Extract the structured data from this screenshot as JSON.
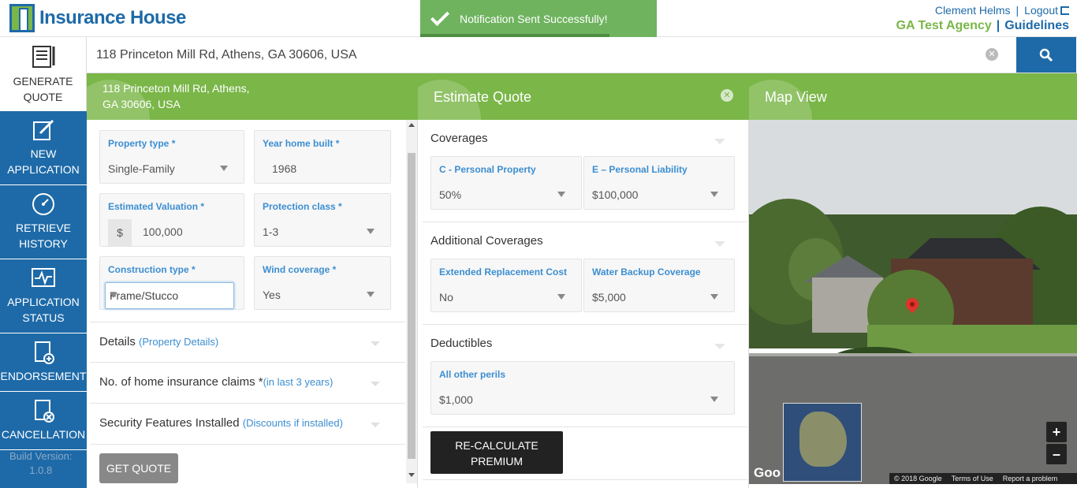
{
  "app": {
    "logo_text": "Insurance House",
    "user_name": "Clement Helms",
    "logout_label": "Logout",
    "agency": "GA Test Agency",
    "guidelines": "Guidelines"
  },
  "notification": {
    "message": "Notification Sent Successfully!"
  },
  "sidebar": {
    "items": [
      {
        "label_line1": "GENERATE",
        "label_line2": "QUOTE",
        "icon": "document-pen-icon"
      },
      {
        "label_line1": "NEW",
        "label_line2": "APPLICATION",
        "icon": "edit-icon"
      },
      {
        "label_line1": "RETRIEVE",
        "label_line2": "HISTORY",
        "icon": "history-icon"
      },
      {
        "label_line1": "APPLICATION",
        "label_line2": "STATUS",
        "icon": "status-monitor-icon"
      },
      {
        "label_line1": "ENDORSEMENT",
        "label_line2": "",
        "icon": "document-plus-icon"
      },
      {
        "label_line1": "CANCELLATION",
        "label_line2": "",
        "icon": "document-cancel-icon"
      }
    ],
    "build_label": "Build Version:",
    "build_value": "1.0.8"
  },
  "search": {
    "value": "118 Princeton Mill Rd, Athens, GA 30606, USA"
  },
  "property_panel": {
    "address_line1": "118 Princeton Mill Rd, Athens,",
    "address_line2": "GA 30606, USA",
    "fields": {
      "property_type": {
        "label": "Property type *",
        "value": "Single-Family"
      },
      "year_built": {
        "label": "Year home built *",
        "value": "1968"
      },
      "valuation": {
        "label": "Estimated Valuation *",
        "prefix": "$",
        "value": "100,000"
      },
      "protection_class": {
        "label": "Protection class *",
        "value": "1-3"
      },
      "construction_type": {
        "label": "Construction type *",
        "value": "Frame/Stucco"
      },
      "wind_coverage": {
        "label": "Wind coverage *",
        "value": "Yes"
      }
    },
    "accordions": [
      {
        "title": "Details",
        "sub": "(Property Details)"
      },
      {
        "title": "No. of home insurance claims *",
        "sub": "(in last 3 years)"
      },
      {
        "title": "Security Features Installed",
        "sub": "(Discounts if installed)"
      }
    ],
    "get_quote": "GET QUOTE"
  },
  "estimate_panel": {
    "title": "Estimate Quote",
    "coverages": {
      "title": "Coverages",
      "personal_property": {
        "label": "C - Personal Property",
        "value": "50%"
      },
      "personal_liability": {
        "label": "E – Personal Liability",
        "value": "$100,000"
      }
    },
    "additional": {
      "title": "Additional Coverages",
      "replacement": {
        "label": "Extended Replacement Cost",
        "value": "No"
      },
      "water_backup": {
        "label": "Water Backup Coverage",
        "value": "$5,000"
      }
    },
    "deductibles": {
      "title": "Deductibles",
      "all_perils": {
        "label": "All other perils",
        "value": "$1,000"
      }
    },
    "recalc_line1": "RE-CALCULATE",
    "recalc_line2": "PREMIUM"
  },
  "map_panel": {
    "title": "Map View",
    "attribution": [
      "© 2018 Google",
      "Terms of Use",
      "Report a problem"
    ],
    "google_label": "Goo",
    "zoom_in": "+",
    "zoom_out": "–"
  },
  "colors": {
    "brand_blue": "#1e6aa8",
    "brand_green": "#7ab648",
    "toast_green": "#6fb35f"
  }
}
